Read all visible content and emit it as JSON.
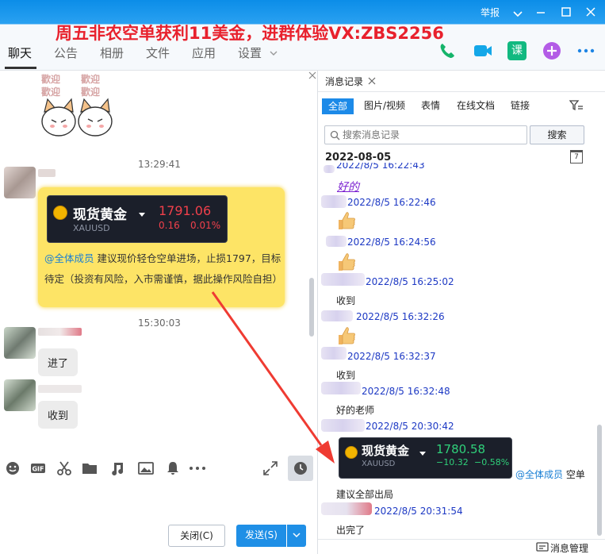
{
  "window": {
    "promo_text": "周五非农空单获利11美金，进群体验VX:ZBS2256",
    "report_label": "举报"
  },
  "tabs": [
    {
      "label": "聊天"
    },
    {
      "label": "公告"
    },
    {
      "label": "相册"
    },
    {
      "label": "文件"
    },
    {
      "label": "应用"
    },
    {
      "label": "设置"
    }
  ],
  "header_actions": {
    "lesson_label": "课"
  },
  "sticker": {
    "text1": "歡迎",
    "text2": "歡迎",
    "text3": "歡迎",
    "text4": "歡迎"
  },
  "chat": {
    "time1": "13:29:41",
    "card": {
      "title": "现货黄金",
      "symbol": "XAUUSD",
      "price": "1791.06",
      "change": "0.16",
      "percent": "0.01%"
    },
    "mention": "@全体成员",
    "message": "建议现价轻仓空单进场，止损1797，目标待定（投资有风险，入市需谨慎，据此操作风险自担）",
    "time2": "15:30:03",
    "reply1": "进了",
    "reply2": "收到"
  },
  "composer": {
    "close_label": "关闭(C)",
    "send_label": "发送(S)"
  },
  "history": {
    "tab_title": "消息记录",
    "filters": [
      {
        "label": "全部"
      },
      {
        "label": "图片/视频"
      },
      {
        "label": "表情"
      },
      {
        "label": "在线文档"
      },
      {
        "label": "链接"
      }
    ],
    "search_placeholder": "搜索消息记录",
    "search_button": "搜索",
    "date": "2022-08-05",
    "calendar_day": "7",
    "items": [
      {
        "time": "2022/8/5 16:22:43",
        "text": "好的"
      },
      {
        "time": "2022/8/5 16:22:46"
      },
      {
        "time": "2022/8/5 16:24:56"
      },
      {
        "time": "2022/8/5 16:25:02",
        "text": "收到"
      },
      {
        "time": "2022/8/5 16:32:26"
      },
      {
        "time": "2022/8/5 16:32:37",
        "text": "收到"
      },
      {
        "time": "2022/8/5 16:32:48",
        "text": "好的老师"
      },
      {
        "time": "2022/8/5 20:30:42"
      },
      {
        "time": "2022/8/5 20:31:54",
        "text": "出完了"
      }
    ],
    "card": {
      "title": "现货黄金",
      "symbol": "XAUUSD",
      "price": "1780.58",
      "change": "−10.32",
      "percent": "−0.58%"
    },
    "mention": "@全体成员",
    "mention_tail": "空单",
    "advice": "建议全部出局",
    "manage_label": "消息管理"
  }
}
